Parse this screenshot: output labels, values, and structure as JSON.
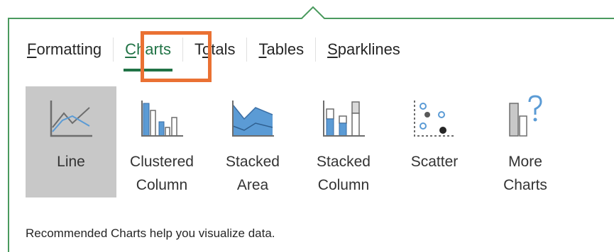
{
  "tabs": [
    {
      "pre": "",
      "key": "F",
      "post": "ormatting"
    },
    {
      "pre": "",
      "key": "C",
      "post": "harts"
    },
    {
      "pre": "T",
      "key": "o",
      "post": "tals"
    },
    {
      "pre": "",
      "key": "T",
      "post": "ables"
    },
    {
      "pre": "",
      "key": "S",
      "post": "parklines"
    }
  ],
  "active_tab": "Charts",
  "chart_options": [
    {
      "line1": "Line",
      "line2": "",
      "icon": "line-chart-icon"
    },
    {
      "line1": "Clustered",
      "line2": "Column",
      "icon": "clustered-column-icon"
    },
    {
      "line1": "Stacked",
      "line2": "Area",
      "icon": "stacked-area-icon"
    },
    {
      "line1": "Stacked",
      "line2": "Column",
      "icon": "stacked-column-icon"
    },
    {
      "line1": "Scatter",
      "line2": "",
      "icon": "scatter-icon"
    },
    {
      "line1": "More",
      "line2": "Charts",
      "icon": "more-charts-icon"
    }
  ],
  "footer_text": "Recommended Charts help you visualize data.",
  "colors": {
    "accent_green": "#217346",
    "highlight_orange": "#ea7133",
    "selected_bg": "#c8c8c8",
    "icon_blue": "#5b9bd5"
  }
}
